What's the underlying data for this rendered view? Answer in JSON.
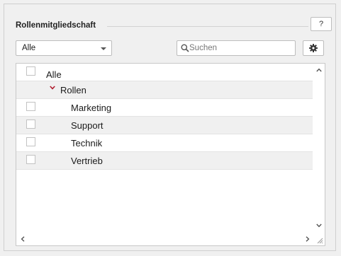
{
  "section": {
    "title": "Rollenmitgliedschaft"
  },
  "toolbar": {
    "help_label": "?",
    "filter_selected": "Alle",
    "search_placeholder": "Suchen"
  },
  "tree": {
    "root": {
      "label": "Alle",
      "checked": false
    },
    "group": {
      "label": "Rollen",
      "expanded": true
    },
    "items": [
      {
        "label": "Marketing",
        "checked": false
      },
      {
        "label": "Support",
        "checked": false
      },
      {
        "label": "Technik",
        "checked": false
      },
      {
        "label": "Vertrieb",
        "checked": false
      }
    ]
  },
  "icons": {
    "search": "search-icon",
    "settings": "gear-icon",
    "expand": "chevron-down-icon",
    "scroll_up": "chevron-up-icon",
    "scroll_down": "chevron-down-icon",
    "scroll_left": "chevron-left-icon",
    "scroll_right": "chevron-right-icon",
    "resize": "resize-grip-icon"
  },
  "colors": {
    "expand_chevron": "#b01c2e",
    "background": "#f0f0f0",
    "alt_row": "#f0f0f0"
  }
}
